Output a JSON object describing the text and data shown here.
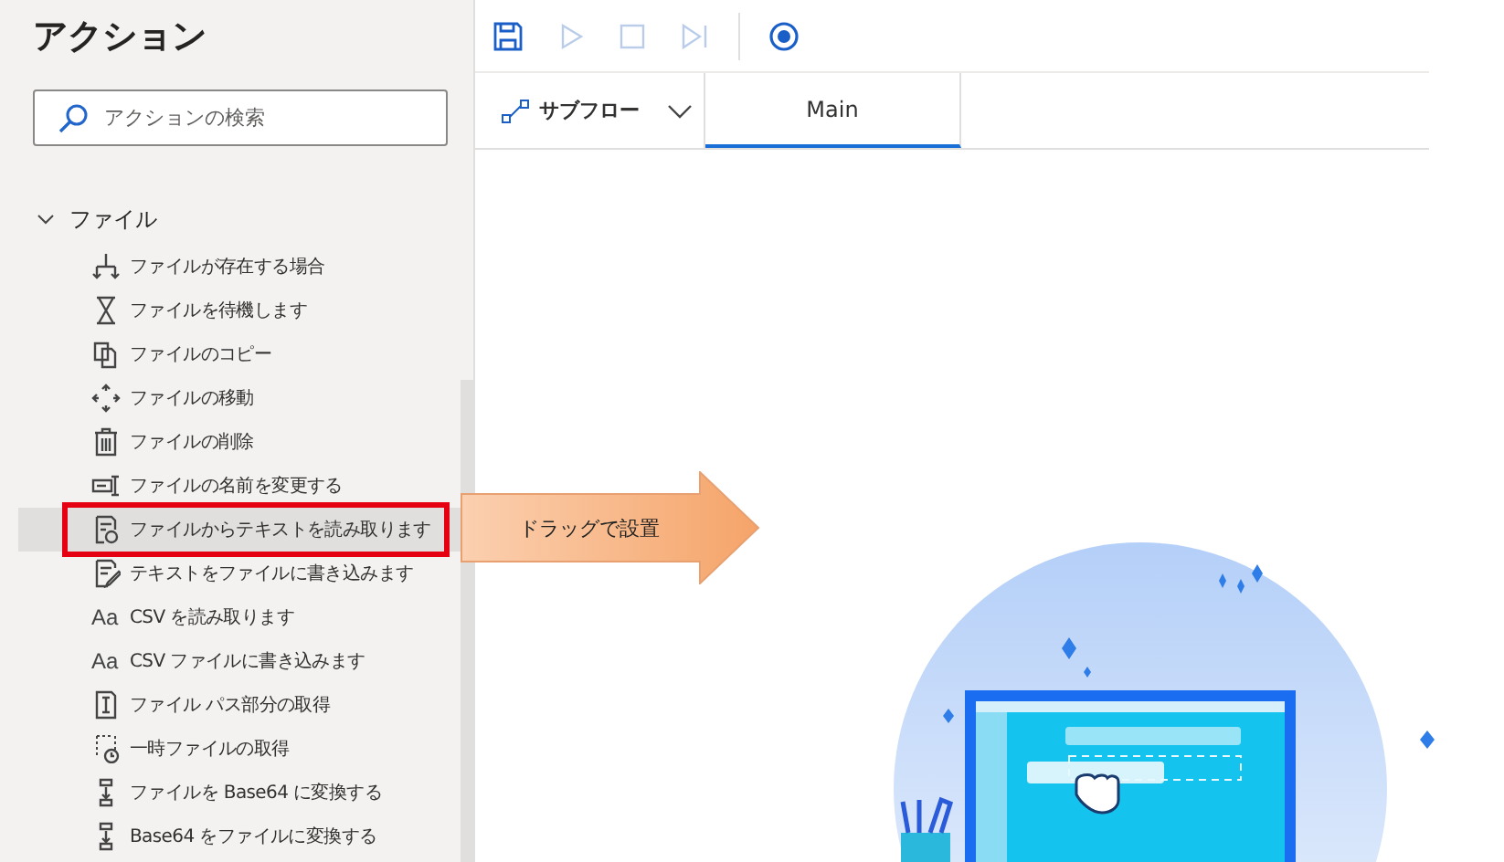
{
  "sidebar": {
    "title": "アクション",
    "search": {
      "placeholder": "アクションの検索"
    },
    "groups": [
      {
        "label": "ファイル",
        "expanded": true,
        "items": [
          {
            "label": "ファイルが存在する場合",
            "selected": false,
            "annotated": false
          },
          {
            "label": "ファイルを待機します",
            "selected": false,
            "annotated": false
          },
          {
            "label": "ファイルのコピー",
            "selected": false,
            "annotated": false
          },
          {
            "label": "ファイルの移動",
            "selected": false,
            "annotated": false
          },
          {
            "label": "ファイルの削除",
            "selected": false,
            "annotated": false
          },
          {
            "label": "ファイルの名前を変更する",
            "selected": false,
            "annotated": false
          },
          {
            "label": "ファイルからテキストを読み取ります",
            "selected": true,
            "annotated": true
          },
          {
            "label": "テキストをファイルに書き込みます",
            "selected": false,
            "annotated": false
          },
          {
            "label": "CSV を読み取ります",
            "icon_text": "Aa",
            "selected": false,
            "annotated": false
          },
          {
            "label": "CSV ファイルに書き込みます",
            "icon_text": "Aa",
            "selected": false,
            "annotated": false
          },
          {
            "label": "ファイル パス部分の取得",
            "selected": false,
            "annotated": false
          },
          {
            "label": "一時ファイルの取得",
            "selected": false,
            "annotated": false
          },
          {
            "label": "ファイルを Base64 に変換する",
            "selected": false,
            "annotated": false
          },
          {
            "label": "Base64 をファイルに変換する",
            "selected": false,
            "annotated": false
          }
        ]
      }
    ]
  },
  "toolbar": {
    "buttons": [
      {
        "disabled": false
      },
      {
        "disabled": true
      },
      {
        "disabled": true
      },
      {
        "disabled": true
      },
      {
        "disabled": false
      }
    ]
  },
  "tabs": {
    "subflow": {
      "label": "サブフロー"
    },
    "items": [
      {
        "label": "Main",
        "selected": true
      }
    ]
  },
  "callout": {
    "text": "ドラッグで設置"
  }
}
